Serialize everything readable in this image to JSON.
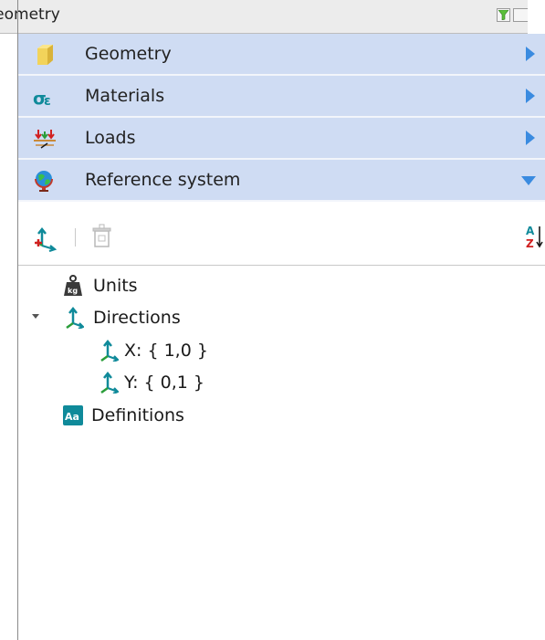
{
  "header": {
    "title": "Geometry"
  },
  "sections": [
    {
      "label": "Geometry",
      "icon": "geometry-block-icon",
      "state": "collapsed"
    },
    {
      "label": "Materials",
      "icon": "materials-sigma-epsilon-icon",
      "state": "collapsed"
    },
    {
      "label": "Loads",
      "icon": "loads-icon",
      "state": "collapsed"
    },
    {
      "label": "Reference system",
      "icon": "globe-icon",
      "state": "expanded"
    }
  ],
  "toolbar": {
    "add": {
      "icon": "add-axes-icon"
    },
    "delete": {
      "icon": "delete-icon"
    },
    "sort": {
      "icon": "sort-az-icon"
    }
  },
  "tree": {
    "units": {
      "label": "Units",
      "icon": "kg-weight-icon"
    },
    "directions": {
      "label": "Directions",
      "icon": "axes-icon",
      "expanded": true
    },
    "x": {
      "label": "X: { 1,0 }",
      "icon": "axes-icon"
    },
    "y": {
      "label": "Y: { 0,1 }",
      "icon": "axes-icon"
    },
    "definitions": {
      "label": "Definitions",
      "icon": "aa-definitions-icon"
    }
  },
  "colors": {
    "section_bg": "#cfdcf3",
    "arrow_blue": "#3a8be0",
    "teal": "#0f8a9a"
  }
}
